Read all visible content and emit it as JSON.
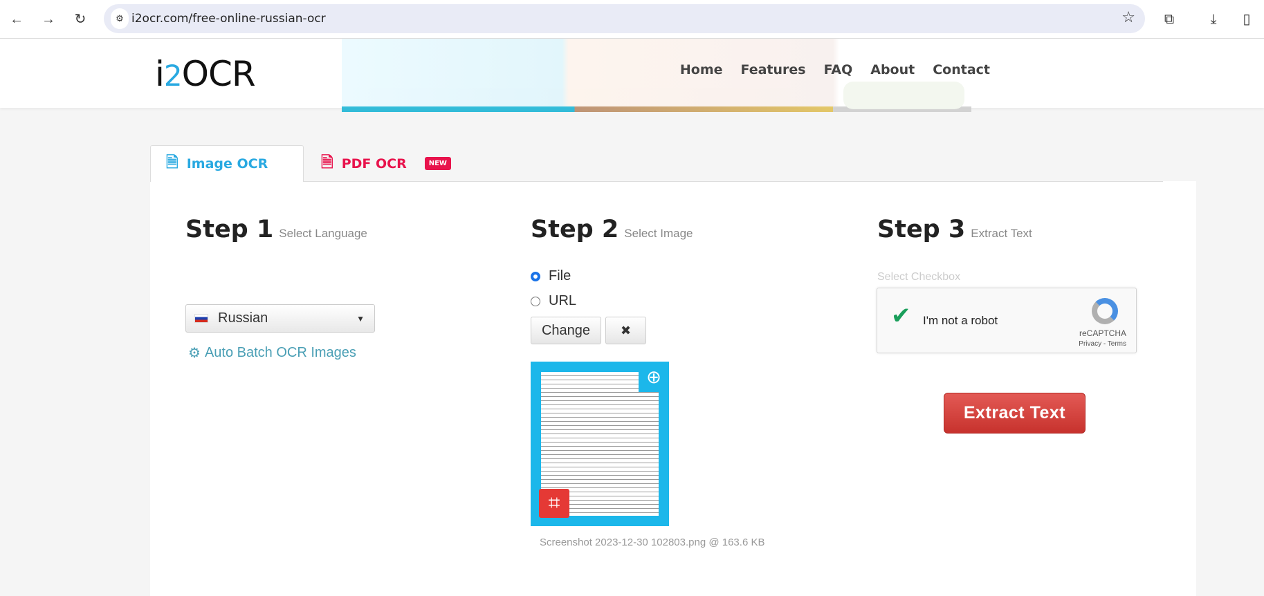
{
  "browser": {
    "url": "i2ocr.com/free-online-russian-ocr"
  },
  "header": {
    "logo_text": "i2OCR",
    "nav": [
      "Home",
      "Features",
      "FAQ",
      "About",
      "Contact"
    ]
  },
  "tabs": [
    {
      "label": "Image OCR",
      "active": true
    },
    {
      "label": "PDF OCR",
      "badge": "NEW"
    }
  ],
  "step1": {
    "title": "Step 1",
    "subtitle": "Select Language",
    "language": "Russian",
    "batch_link": "Auto Batch OCR Images"
  },
  "step2": {
    "title": "Step 2",
    "subtitle": "Select Image",
    "options": [
      "File",
      "URL"
    ],
    "selected": "File",
    "change_label": "Change",
    "remove_label": "✖",
    "file_info": "Screenshot 2023-12-30 102803.png @ 163.6 KB"
  },
  "step3": {
    "title": "Step 3",
    "subtitle": "Extract Text",
    "checkbox_label": "Select Checkbox",
    "captcha_text": "I'm not a robot",
    "captcha_brand": "reCAPTCHA",
    "captcha_links": "Privacy - Terms",
    "extract_label": "Extract Text"
  },
  "colors": {
    "accent": "#29a9e1",
    "pdf": "#e8134c",
    "extract": "#d9443f",
    "thumb_border": "#1cb7ea"
  }
}
